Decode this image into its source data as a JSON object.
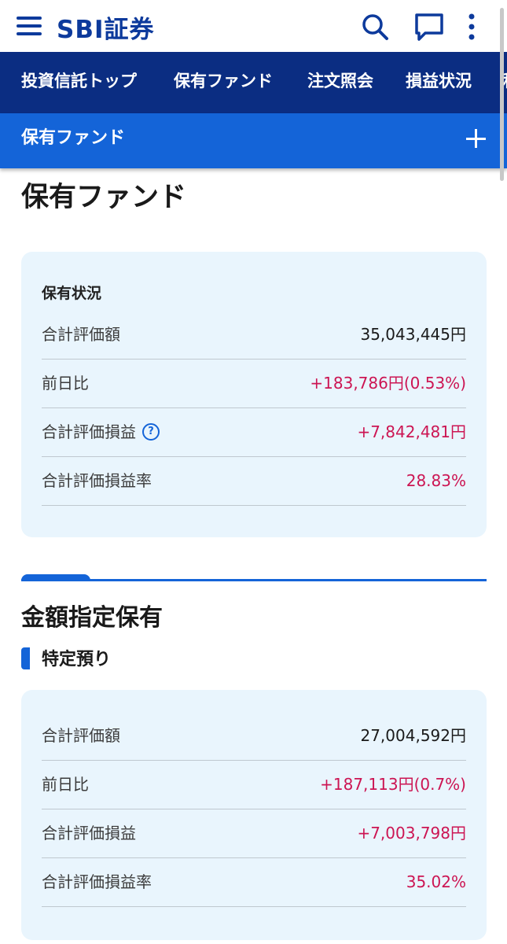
{
  "header": {
    "logo_text": "SBI証券",
    "menu_icon": "menu-icon",
    "search_icon": "search-icon",
    "chat_icon": "chat-icon",
    "more_icon": "more-vertical-icon",
    "brand_color": "#0d3a9c"
  },
  "nav": {
    "items": [
      {
        "label": "投資信託トップ"
      },
      {
        "label": "保有ファンド"
      },
      {
        "label": "注文照会"
      },
      {
        "label": "損益状況"
      },
      {
        "label": "積"
      }
    ]
  },
  "subbar": {
    "title": "保有ファンド",
    "plus_icon": "plus-icon"
  },
  "page": {
    "title": "保有ファンド"
  },
  "summary": {
    "title": "保有状況",
    "rows": [
      {
        "label": "合計評価額",
        "value": "35,043,445円"
      },
      {
        "label": "前日比",
        "value": "+183,786円(0.53%)"
      },
      {
        "label": "合計評価損益",
        "value": "+7,842,481円",
        "help": "?"
      },
      {
        "label": "合計評価損益率",
        "value": "28.83%"
      }
    ]
  },
  "amount_section": {
    "title": "金額指定保有",
    "subtitle": "特定預り",
    "rows": [
      {
        "label": "合計評価額",
        "value": "27,004,592円"
      },
      {
        "label": "前日比",
        "value": "+187,113円(0.7%)"
      },
      {
        "label": "合計評価損益",
        "value": "+7,003,798円"
      },
      {
        "label": "合計評価損益率",
        "value": "35.02%"
      }
    ]
  },
  "colors": {
    "nav_bg": "#0b2d82",
    "subbar_bg": "#1464d8",
    "positive": "#cc1553",
    "card_bg": "#e9f5fd"
  }
}
